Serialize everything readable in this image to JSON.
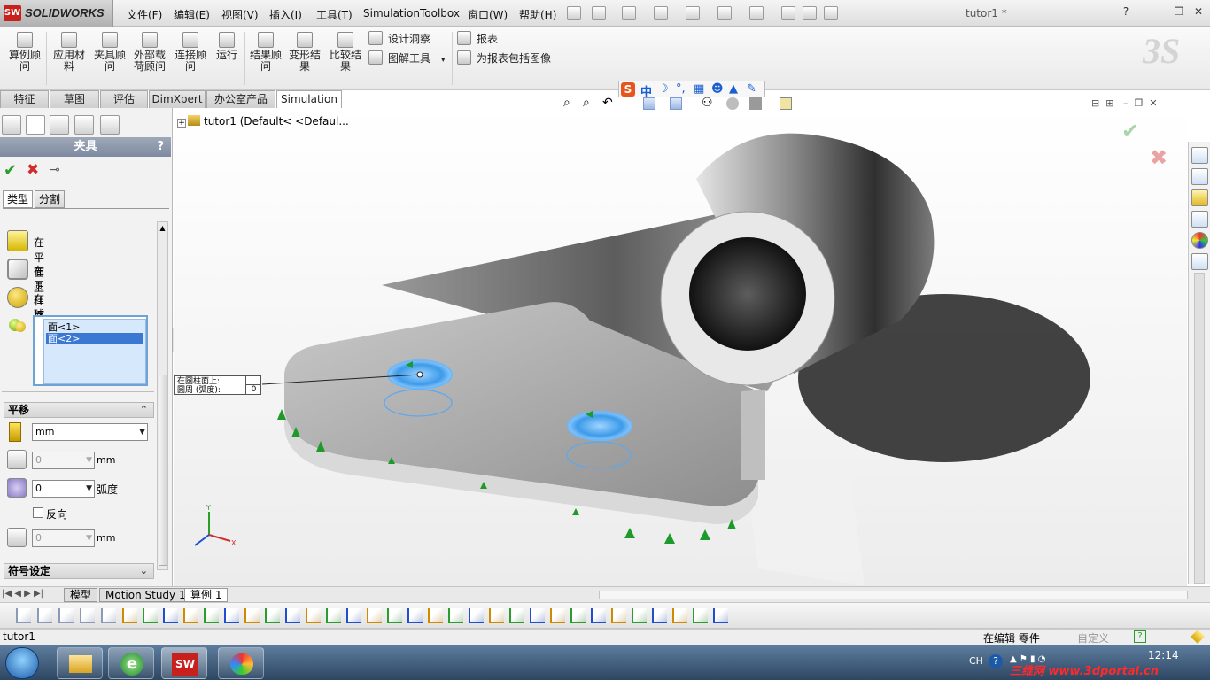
{
  "app": {
    "logo_text": "SOLIDWORKS",
    "logo_badge": "SW",
    "doc_title": "tutor1 *"
  },
  "menu": [
    "文件(F)",
    "编辑(E)",
    "视图(V)",
    "插入(I)",
    "工具(T)",
    "Simulation",
    "Toolbox",
    "窗口(W)",
    "帮助(H)"
  ],
  "ribbon": {
    "big_buttons": [
      "算例顾问",
      "应用材料",
      "夹具顾问",
      "外部载荷顾问",
      "连接顾问",
      "运行",
      "结果顾问",
      "变形结果",
      "比较结果"
    ],
    "small_buttons": [
      "设计洞察",
      "图解工具",
      "报表",
      "为报表包括图像"
    ]
  },
  "tabs": [
    "特征",
    "草图",
    "评估",
    "DimXpert",
    "办公室产品",
    "Simulation"
  ],
  "active_tab": "Simulation",
  "property_manager": {
    "title": "夹具",
    "help": "?",
    "subtabs": [
      "类型",
      "分割"
    ],
    "options": [
      "在平面上",
      "在圆柱面上",
      "在球面上"
    ],
    "faces": [
      "面<1>",
      "面<2>"
    ],
    "translation_header": "平移",
    "unit": "mm",
    "field1_value": "0",
    "field1_unit": "mm",
    "field2_value": "0",
    "field2_unit": "弧度",
    "reverse_label": "反向",
    "field3_value": "0",
    "field3_unit": "mm",
    "symbol_header": "符号设定"
  },
  "tree": {
    "root": "tutor1  (Default< <Defaul..."
  },
  "callout": {
    "line1": "在圆柱面上:",
    "line2": "圆周 (弧度):",
    "value": "0"
  },
  "ime": {
    "s": "S",
    "zh": "中"
  },
  "bottom_tabs": [
    "模型",
    "Motion Study 1",
    "算例 1"
  ],
  "active_bottom_tab": "算例 1",
  "status": {
    "left": "tutor1",
    "editing": "在编辑 零件",
    "custom": "自定义"
  },
  "taskbar": {
    "lang": "CH",
    "time": "12:14",
    "watermark": "三维网 www.3dportal.cn"
  },
  "colors": {
    "accent": "#3b78d3",
    "sw_red": "#c8201d",
    "ok_green": "#2a9d2a",
    "cancel_red": "#d22b2b"
  }
}
